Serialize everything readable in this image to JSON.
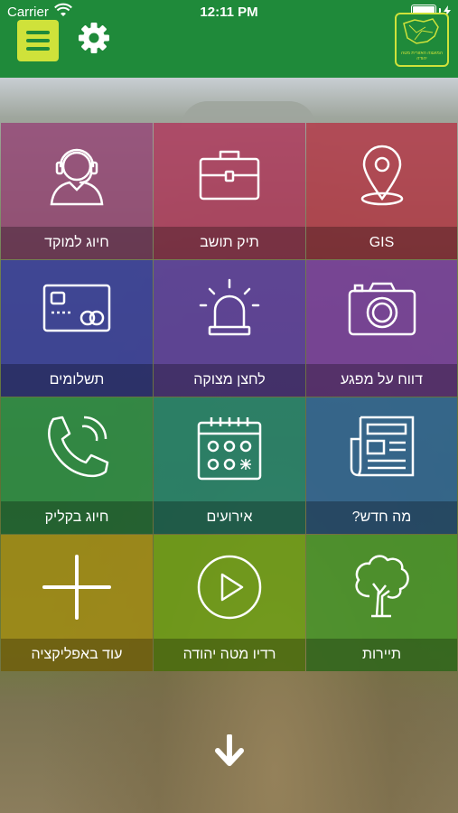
{
  "status_bar": {
    "carrier": "Carrier",
    "time": "12:11 PM"
  },
  "header": {
    "logo_caption": "המועצה האזורית מטה יהודה"
  },
  "tiles": [
    {
      "label": "חיוג למוקד",
      "icon": "headset-agent-icon",
      "color": "#96467a"
    },
    {
      "label": "תיק תושב",
      "icon": "briefcase-icon",
      "color": "#af3c5f"
    },
    {
      "label": "GIS",
      "icon": "map-pin-icon",
      "color": "#b43c4b"
    },
    {
      "label": "תשלומים",
      "icon": "credit-card-icon",
      "color": "#373ca0"
    },
    {
      "label": "לחצן מצוקה",
      "icon": "siren-icon",
      "color": "#5a3ca0"
    },
    {
      "label": "דווח על מפגע",
      "icon": "camera-icon",
      "color": "#783ca0"
    },
    {
      "label": "חיוג בקליק",
      "icon": "phone-icon",
      "color": "#288c46"
    },
    {
      "label": "אירועים",
      "icon": "calendar-icon",
      "color": "#1e826e"
    },
    {
      "label": "מה חדש?",
      "icon": "newspaper-icon",
      "color": "#2d6496"
    },
    {
      "label": "עוד באפליקציה",
      "icon": "plus-icon",
      "color": "#a58c14"
    },
    {
      "label": "רדיו מטה יהודה",
      "icon": "play-icon",
      "color": "#6ea014"
    },
    {
      "label": "תיירות",
      "icon": "tree-icon",
      "color": "#469628"
    }
  ]
}
